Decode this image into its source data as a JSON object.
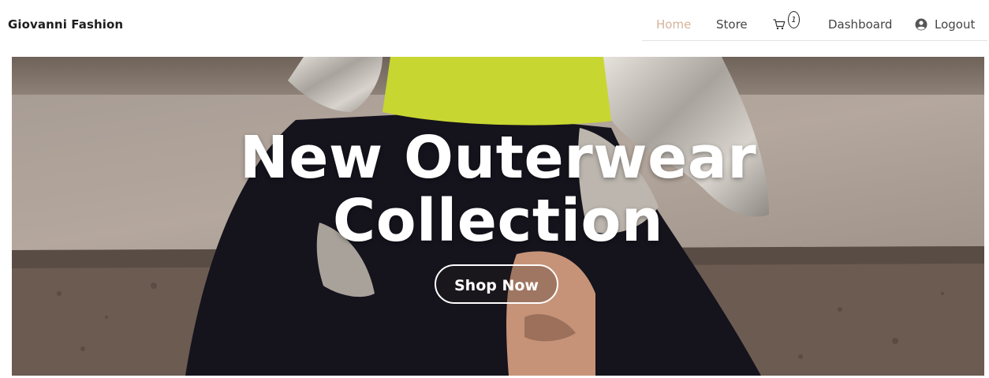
{
  "brand": {
    "name": "Giovanni Fashion"
  },
  "nav": {
    "home": "Home",
    "store": "Store",
    "cart_count": "1",
    "dashboard": "Dashboard",
    "logout": "Logout",
    "active_color": "#d4b39a"
  },
  "hero": {
    "title_line1": "New Outerwear",
    "title_line2": "Collection",
    "cta": "Shop Now"
  },
  "icons": {
    "cart": "cart-icon",
    "user": "user-circle-icon"
  }
}
